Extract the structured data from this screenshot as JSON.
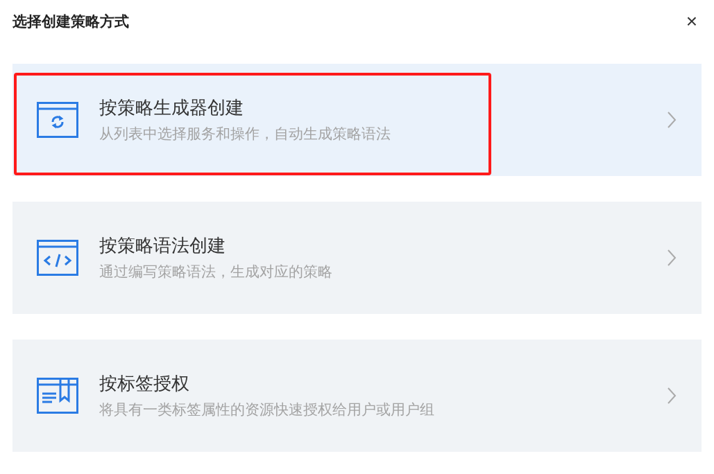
{
  "dialog": {
    "title": "选择创建策略方式",
    "close": "×"
  },
  "options": [
    {
      "kind": "generator",
      "title": "按策略生成器创建",
      "description": "从列表中选择服务和操作，自动生成策略语法",
      "highlighted": true
    },
    {
      "kind": "syntax",
      "title": "按策略语法创建",
      "description": "通过编写策略语法，生成对应的策略",
      "highlighted": false
    },
    {
      "kind": "tag",
      "title": "按标签授权",
      "description": "将具有一类标签属性的资源快速授权给用户或用户组",
      "highlighted": false
    }
  ]
}
